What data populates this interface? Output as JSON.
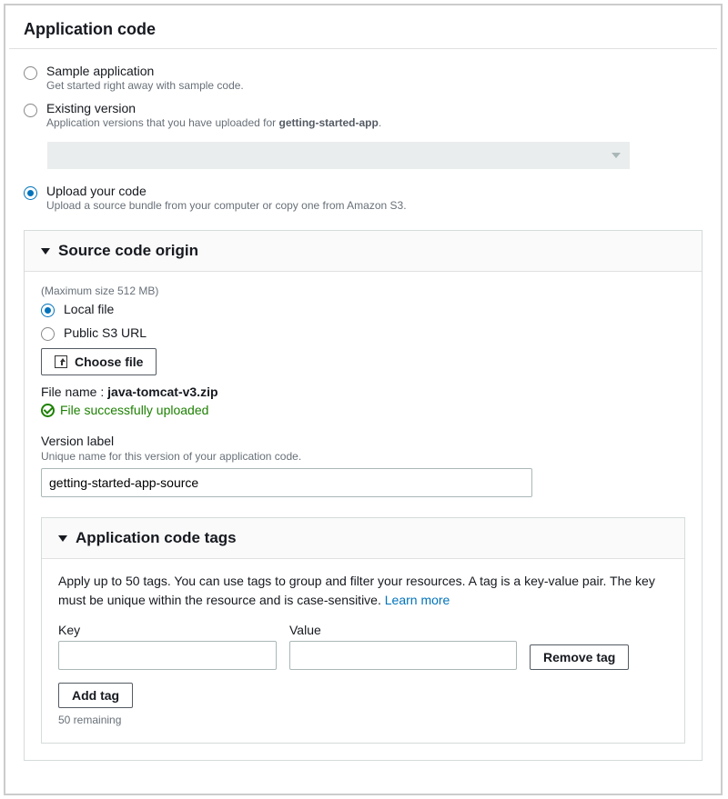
{
  "title": "Application code",
  "options": {
    "sample": {
      "label": "Sample application",
      "desc": "Get started right away with sample code."
    },
    "existing": {
      "label": "Existing version",
      "desc_prefix": "Application versions that you have uploaded for ",
      "desc_app": "getting-started-app",
      "desc_suffix": "."
    },
    "upload": {
      "label": "Upload your code",
      "desc": "Upload a source bundle from your computer or copy one from Amazon S3."
    }
  },
  "source_origin": {
    "title": "Source code origin",
    "max_size": "(Maximum size 512 MB)",
    "local_label": "Local file",
    "s3_label": "Public S3 URL",
    "choose_file": "Choose file",
    "file_name_label": "File name : ",
    "file_name": "java-tomcat-v3.zip",
    "upload_success": "File successfully uploaded",
    "version_label": "Version label",
    "version_desc": "Unique name for this version of your application code.",
    "version_value": "getting-started-app-source"
  },
  "tags": {
    "title": "Application code tags",
    "desc": "Apply up to 50 tags. You can use tags to group and filter your resources. A tag is a key-value pair. The key must be unique within the resource and is case-sensitive. ",
    "learn_more": "Learn more",
    "key_label": "Key",
    "value_label": "Value",
    "remove": "Remove tag",
    "add": "Add tag",
    "remaining": "50 remaining"
  }
}
